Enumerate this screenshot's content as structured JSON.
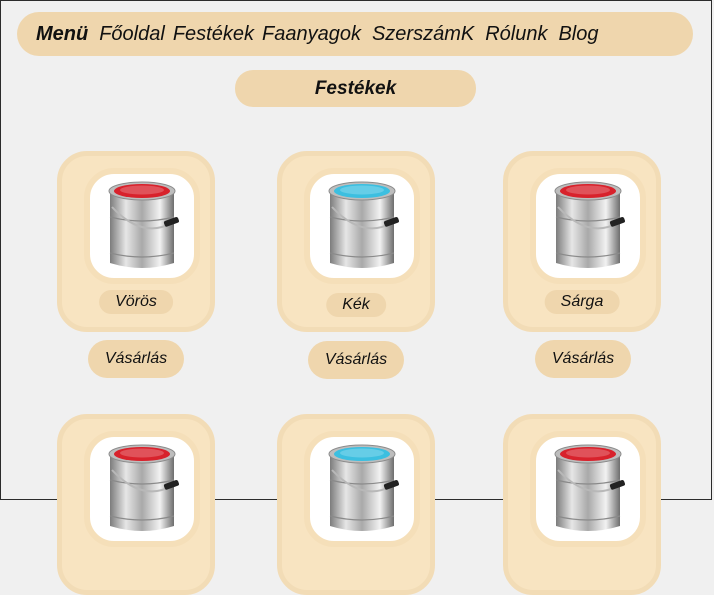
{
  "nav": {
    "menu_label": "Menü",
    "links": [
      "Főoldal",
      "Festékek",
      "Faanyagok",
      "SzerszámK",
      "Rólunk",
      "Blog"
    ]
  },
  "page_title": "Festékek",
  "products": [
    {
      "name": "Vörös",
      "buy_label": "Vásárlás",
      "paint_color": "#d8222c",
      "icon": "red-paint-can-icon"
    },
    {
      "name": "Kék",
      "buy_label": "Vásárlás",
      "paint_color": "#3cbfe0",
      "icon": "blue-paint-can-icon"
    },
    {
      "name": "Sárga",
      "buy_label": "Vásárlás",
      "paint_color": "#d8222c",
      "icon": "red-paint-can-icon"
    },
    {
      "paint_color": "#d8222c",
      "icon": "red-paint-can-icon"
    },
    {
      "paint_color": "#3cbfe0",
      "icon": "blue-paint-can-icon"
    },
    {
      "paint_color": "#d8222c",
      "icon": "red-paint-can-icon"
    }
  ],
  "colors": {
    "accent": "#efd6ad",
    "card_bg": "#f8e4c1",
    "page_bg": "#f0f0f0"
  }
}
